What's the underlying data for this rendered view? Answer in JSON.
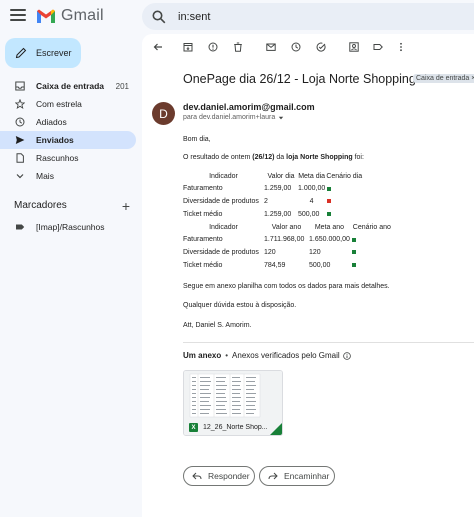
{
  "header": {
    "app_name": "Gmail",
    "search_value": "in:sent"
  },
  "sidebar": {
    "compose_label": "Escrever",
    "items": [
      {
        "label": "Caixa de entrada",
        "count": "201",
        "icon": "inbox-icon"
      },
      {
        "label": "Com estrela",
        "icon": "star-icon"
      },
      {
        "label": "Adiados",
        "icon": "clock-icon"
      },
      {
        "label": "Enviados",
        "icon": "send-icon"
      },
      {
        "label": "Rascunhos",
        "icon": "draft-icon"
      },
      {
        "label": "Mais",
        "icon": "chevron-down-icon"
      }
    ],
    "labels_title": "Marcadores",
    "labels_add": "+",
    "labels": [
      {
        "label": "[Imap]/Rascunhos",
        "icon": "label-icon"
      }
    ]
  },
  "email": {
    "subject": "OnePage dia 26/12 - Loja Norte Shopping",
    "folder_badge": "Caixa de entrada ×",
    "avatar_letter": "D",
    "sender": "dev.daniel.amorim@gmail.com",
    "to_line": "para dev.daniel.amorim+laura",
    "greeting": "Bom dia,",
    "intro_prefix": "O resultado de ontem ",
    "intro_bold": "(26/12)",
    "intro_mid": " da ",
    "intro_bold2": "loja Norte Shopping",
    "intro_suffix": " foi:",
    "table_day": {
      "headers": [
        "Indicador",
        "Valor dia",
        "Meta dia",
        "Cenário dia"
      ],
      "rows": [
        {
          "name": "Faturamento",
          "value": "1.259,00",
          "goal": "1.000,00",
          "status": "ok"
        },
        {
          "name": "Diversidade de produtos",
          "value": "2",
          "goal": "4",
          "status": "bad"
        },
        {
          "name": "Ticket médio",
          "value": "1.259,00",
          "goal": "500,00",
          "status": "ok"
        }
      ]
    },
    "table_year": {
      "headers": [
        "Indicador",
        "Valor ano",
        "Meta ano",
        "Cenário ano"
      ],
      "rows": [
        {
          "name": "Faturamento",
          "value": "1.711.968,00",
          "goal": "1.650.000,00",
          "status": "ok"
        },
        {
          "name": "Diversidade de produtos",
          "value": "120",
          "goal": "120",
          "status": "ok"
        },
        {
          "name": "Ticket médio",
          "value": "784,59",
          "goal": "500,00",
          "status": "ok"
        }
      ]
    },
    "line_attach": "Segue em anexo planilha com todos os dados para mais detalhes.",
    "line_doubt": "Qualquer dúvida estou à disposição.",
    "signature": "Att, Daniel S. Amorim.",
    "attachments_title": "Um anexo",
    "attachments_sep": "•",
    "attachments_note": "Anexos verificados pelo Gmail",
    "attachment_name": "12_26_Norte Shop...",
    "reply_label": "Responder",
    "forward_label": "Encaminhar"
  },
  "colors": {
    "accent": "#c2e7ff",
    "active_nav": "#d3e3fd",
    "ok_marker": "#188038",
    "bad_marker": "#d93025"
  }
}
